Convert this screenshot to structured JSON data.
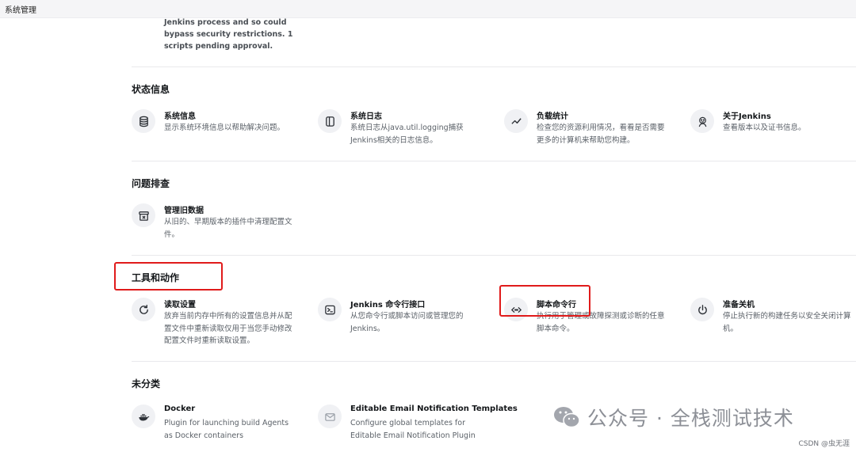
{
  "header": {
    "title": "系统管理"
  },
  "fragment": {
    "text": "Jenkins process and so could bypass security restrictions. 1 scripts pending approval."
  },
  "sections": {
    "status": {
      "title": "状态信息",
      "items": [
        {
          "title": "系统信息",
          "desc": "显示系统环境信息以帮助解决问题。",
          "icon": "database-icon"
        },
        {
          "title": "系统日志",
          "desc": "系统日志从java.util.logging捕获Jenkins相关的日志信息。",
          "icon": "log-panel-icon"
        },
        {
          "title": "负载统计",
          "desc": "检查您的资源利用情况，看看是否需要更多的计算机来帮助您构建。",
          "icon": "trend-icon"
        },
        {
          "title": "关于Jenkins",
          "desc": "查看版本以及证书信息。",
          "icon": "jenkins-butler-icon"
        }
      ]
    },
    "troubleshoot": {
      "title": "问题排查",
      "items": [
        {
          "title": "管理旧数据",
          "desc": "从旧的、早期版本的插件中清理配置文件。",
          "icon": "archive-icon"
        }
      ]
    },
    "tools": {
      "title": "工具和动作",
      "items": [
        {
          "title": "读取设置",
          "desc": "放弃当前内存中所有的设置信息并从配置文件中重新读取仅用于当您手动修改配置文件时重新读取设置。",
          "icon": "reload-icon"
        },
        {
          "title": "Jenkins 命令行接口",
          "desc": "从您命令行或脚本访问或管理您的Jenkins。",
          "icon": "terminal-icon"
        },
        {
          "title": "脚本命令行",
          "desc": "执行用于管理或故障探测或诊断的任意脚本命令。",
          "icon": "code-icon"
        },
        {
          "title": "准备关机",
          "desc": "停止执行新的构建任务以安全关闭计算机。",
          "icon": "power-icon"
        }
      ]
    },
    "uncategorized": {
      "title": "未分类",
      "items": [
        {
          "title": "Docker",
          "desc": "Plugin for launching build Agents as Docker containers",
          "icon": "docker-icon"
        },
        {
          "title": "Editable Email Notification Templates",
          "desc": "Configure global templates for Editable Email Notification Plugin",
          "icon": "email-template-icon"
        }
      ]
    }
  },
  "watermark": {
    "text": "公众号 · 全栈测试技术"
  },
  "credit": {
    "text": "CSDN @虫无涯"
  },
  "colors": {
    "highlight": "#e01b1b",
    "icon_bg": "#f0f1f4"
  }
}
